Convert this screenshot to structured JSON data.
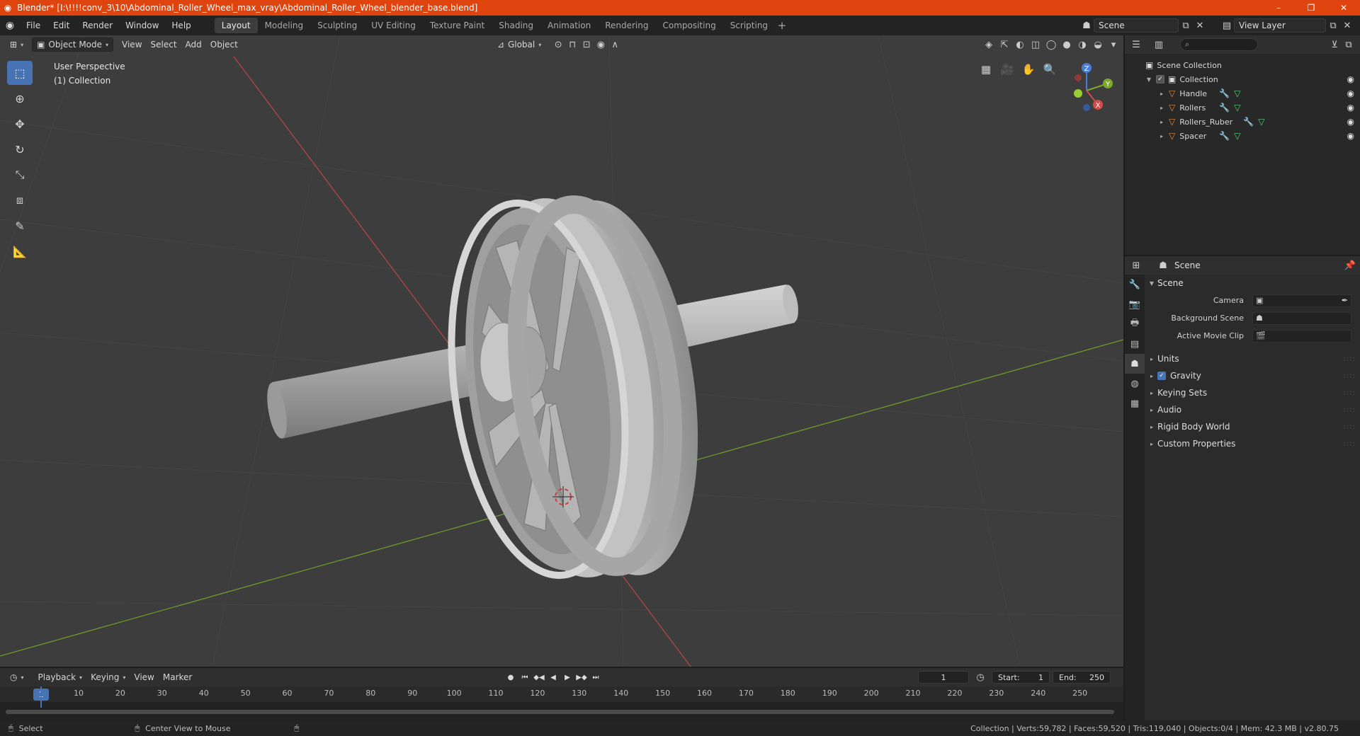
{
  "window": {
    "title": "Blender* [I:\\!!!!conv_3\\10\\Abdominal_Roller_Wheel_max_vray\\Abdominal_Roller_Wheel_blender_base.blend]",
    "controls": [
      "–",
      "❐",
      "✕"
    ]
  },
  "menu": [
    "File",
    "Edit",
    "Render",
    "Window",
    "Help"
  ],
  "workspaces": [
    "Layout",
    "Modeling",
    "Sculpting",
    "UV Editing",
    "Texture Paint",
    "Shading",
    "Animation",
    "Rendering",
    "Compositing",
    "Scripting"
  ],
  "active_workspace": "Layout",
  "scene_selector": "Scene",
  "view_layer": "View Layer",
  "viewport": {
    "mode": "Object Mode",
    "menus": [
      "View",
      "Select",
      "Add",
      "Object"
    ],
    "orientation": "Global",
    "info_line1": "User Perspective",
    "info_line2": "(1) Collection",
    "gizmo_axes": [
      "Z",
      "Y",
      "X"
    ]
  },
  "outliner": {
    "root": "Scene Collection",
    "collection": "Collection",
    "objects": [
      "Handle",
      "Rollers",
      "Rollers_Ruber",
      "Spacer"
    ]
  },
  "properties": {
    "header": "Scene",
    "panel": "Scene",
    "fields": [
      {
        "label": "Camera",
        "value": ""
      },
      {
        "label": "Background Scene",
        "value": ""
      },
      {
        "label": "Active Movie Clip",
        "value": ""
      }
    ],
    "subpanels": [
      {
        "label": "Units",
        "checkbox": false
      },
      {
        "label": "Gravity",
        "checkbox": true
      },
      {
        "label": "Keying Sets",
        "checkbox": false
      },
      {
        "label": "Audio",
        "checkbox": false
      },
      {
        "label": "Rigid Body World",
        "checkbox": false
      },
      {
        "label": "Custom Properties",
        "checkbox": false
      }
    ]
  },
  "timeline": {
    "menus": [
      "Playback",
      "Keying",
      "View",
      "Marker"
    ],
    "current_frame": "1",
    "start_label": "Start:",
    "start": "1",
    "end_label": "End:",
    "end": "250",
    "ruler": [
      "10",
      "20",
      "30",
      "40",
      "50",
      "60",
      "70",
      "80",
      "90",
      "100",
      "110",
      "120",
      "130",
      "140",
      "150",
      "160",
      "170",
      "180",
      "190",
      "200",
      "210",
      "220",
      "230",
      "240",
      "250"
    ],
    "ruler_current": "1"
  },
  "statusbar": {
    "left1": "Select",
    "left2": "Center View to Mouse",
    "right": "Collection | Verts:59,782 | Faces:59,520 | Tris:119,040 | Objects:0/4 | Mem: 42.3 MB | v2.80.75"
  },
  "colors": {
    "titlebar": "#e0440e",
    "accent": "#4772b3",
    "object_icon": "#e88a35",
    "mesh_icon": "#4fd37a",
    "axis_x": "#c84040",
    "axis_y": "#6d9a2a"
  }
}
